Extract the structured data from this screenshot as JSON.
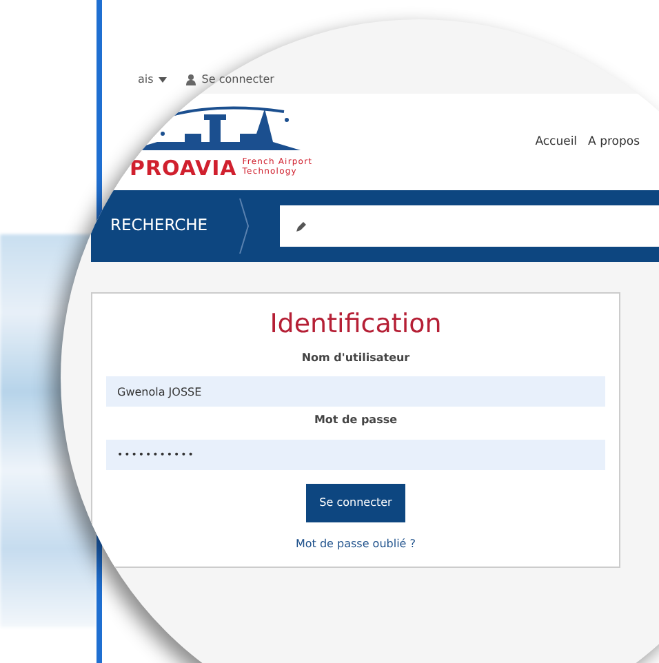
{
  "top_bar": {
    "language": "ais",
    "login_link": "Se connecter"
  },
  "header": {
    "logo": {
      "name": "PROAVIA",
      "tagline_1": "French Airport",
      "tagline_2": "Technology"
    },
    "nav": [
      {
        "label": "Accueil"
      },
      {
        "label": "A propos"
      }
    ]
  },
  "search_bar": {
    "label": "RECHERCHE"
  },
  "login_form": {
    "title": "Identification",
    "fields": [
      {
        "label": "Nom d'utilisateur",
        "value": "Gwenola JOSSE",
        "kind": "text"
      },
      {
        "label": "Mot de passe",
        "value": "•••••••••••",
        "kind": "password"
      }
    ],
    "submit": "Se connecter",
    "forgot_link": "Mot de passe oublié ?"
  }
}
